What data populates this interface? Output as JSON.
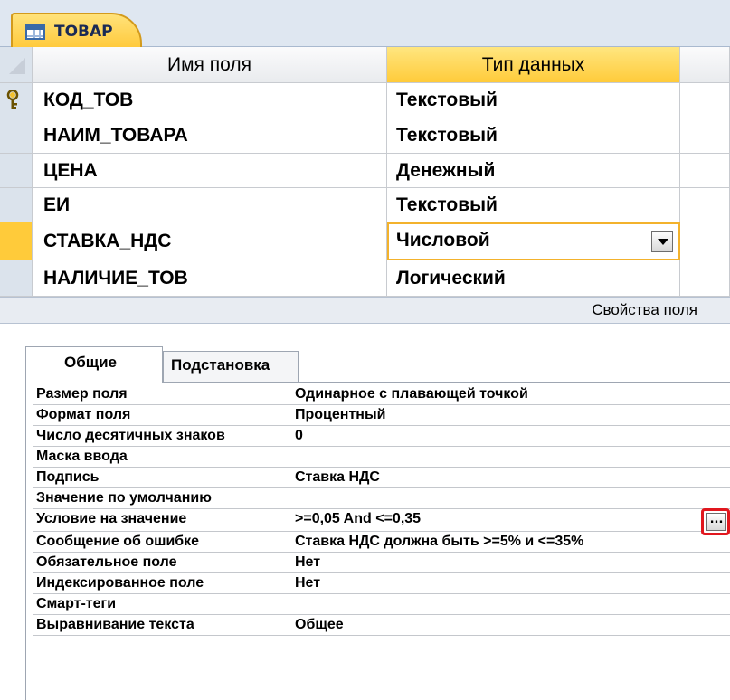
{
  "document_tab": {
    "title": "ТОВАР",
    "icon": "table-icon"
  },
  "field_grid": {
    "headers": [
      "Имя поля",
      "Тип данных"
    ],
    "rows": [
      {
        "name": "КОД_ТОВ",
        "type": "Текстовый",
        "primary_key": true
      },
      {
        "name": "НАИМ_ТОВАРА",
        "type": "Текстовый"
      },
      {
        "name": "ЦЕНА",
        "type": "Денежный"
      },
      {
        "name": "ЕИ",
        "type": "Текстовый"
      },
      {
        "name": "СТАВКА_НДС",
        "type": "Числовой",
        "current": true
      },
      {
        "name": "НАЛИЧИЕ_ТОВ",
        "type": "Логический"
      }
    ]
  },
  "field_properties_label": "Свойства поля",
  "property_tabs": [
    "Общие",
    "Подстановка"
  ],
  "properties": [
    {
      "label": "Размер поля",
      "value": "Одинарное с плавающей точкой"
    },
    {
      "label": "Формат поля",
      "value": "Процентный"
    },
    {
      "label": "Число десятичных знаков",
      "value": "0"
    },
    {
      "label": "Маска ввода",
      "value": ""
    },
    {
      "label": "Подпись",
      "value": "Ставка НДС"
    },
    {
      "label": "Значение по умолчанию",
      "value": ""
    },
    {
      "label": "Условие на значение",
      "value": ">=0,05 And <=0,35"
    },
    {
      "label": "Сообщение об ошибке",
      "value": "Ставка НДС должна быть >=5% и <=35%"
    },
    {
      "label": "Обязательное поле",
      "value": "Нет"
    },
    {
      "label": "Индексированное поле",
      "value": "Нет"
    },
    {
      "label": "Смарт-теги",
      "value": ""
    },
    {
      "label": "Выравнивание текста",
      "value": "Общее"
    }
  ],
  "builder_button_label": "...",
  "colors": {
    "accent_yellow": "#ffcb3a",
    "highlight_red": "#e1171e",
    "tab_blue": "#dfe7f1"
  }
}
